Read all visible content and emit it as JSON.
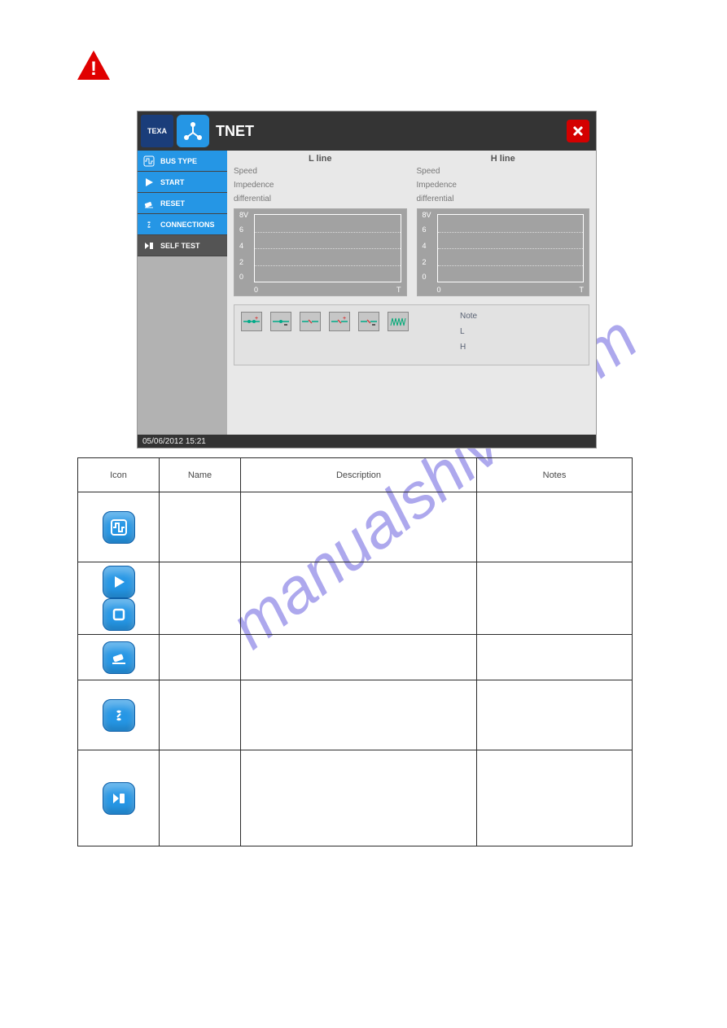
{
  "watermark": "manualshive.com",
  "app": {
    "logo": "TEXA",
    "title": "TNET",
    "status_timestamp": "05/06/2012 15:21",
    "sidebar": [
      {
        "label": "BUS TYPE",
        "name": "bus-type"
      },
      {
        "label": "START",
        "name": "start"
      },
      {
        "label": "RESET",
        "name": "reset"
      },
      {
        "label": "CONNECTIONS",
        "name": "connections"
      },
      {
        "label": "SELF TEST",
        "name": "self-test"
      }
    ],
    "columns": {
      "left": {
        "title": "L line",
        "params": [
          "Speed",
          "Impedence",
          "differential"
        ]
      },
      "right": {
        "title": "H line",
        "params": [
          "Speed",
          "Impedence",
          "differential"
        ]
      }
    },
    "notes": {
      "title": "Note",
      "rows": [
        "L",
        "H"
      ]
    },
    "chart_data": [
      {
        "type": "line",
        "title": "L line",
        "series": [],
        "xlabel": "T",
        "ylabel": "8V",
        "ylim": [
          0,
          8
        ],
        "xlim": [
          0,
          null
        ],
        "y_ticks": [
          0,
          2,
          4,
          6,
          8
        ],
        "x_ticks": [
          "0",
          "T"
        ]
      },
      {
        "type": "line",
        "title": "H line",
        "series": [],
        "xlabel": "T",
        "ylabel": "8V",
        "ylim": [
          0,
          8
        ],
        "xlim": [
          0,
          null
        ],
        "y_ticks": [
          0,
          2,
          4,
          6,
          8
        ],
        "x_ticks": [
          "0",
          "T"
        ]
      }
    ]
  },
  "table": {
    "headers": [
      "Icon",
      "Name",
      "Description",
      "Notes"
    ]
  }
}
